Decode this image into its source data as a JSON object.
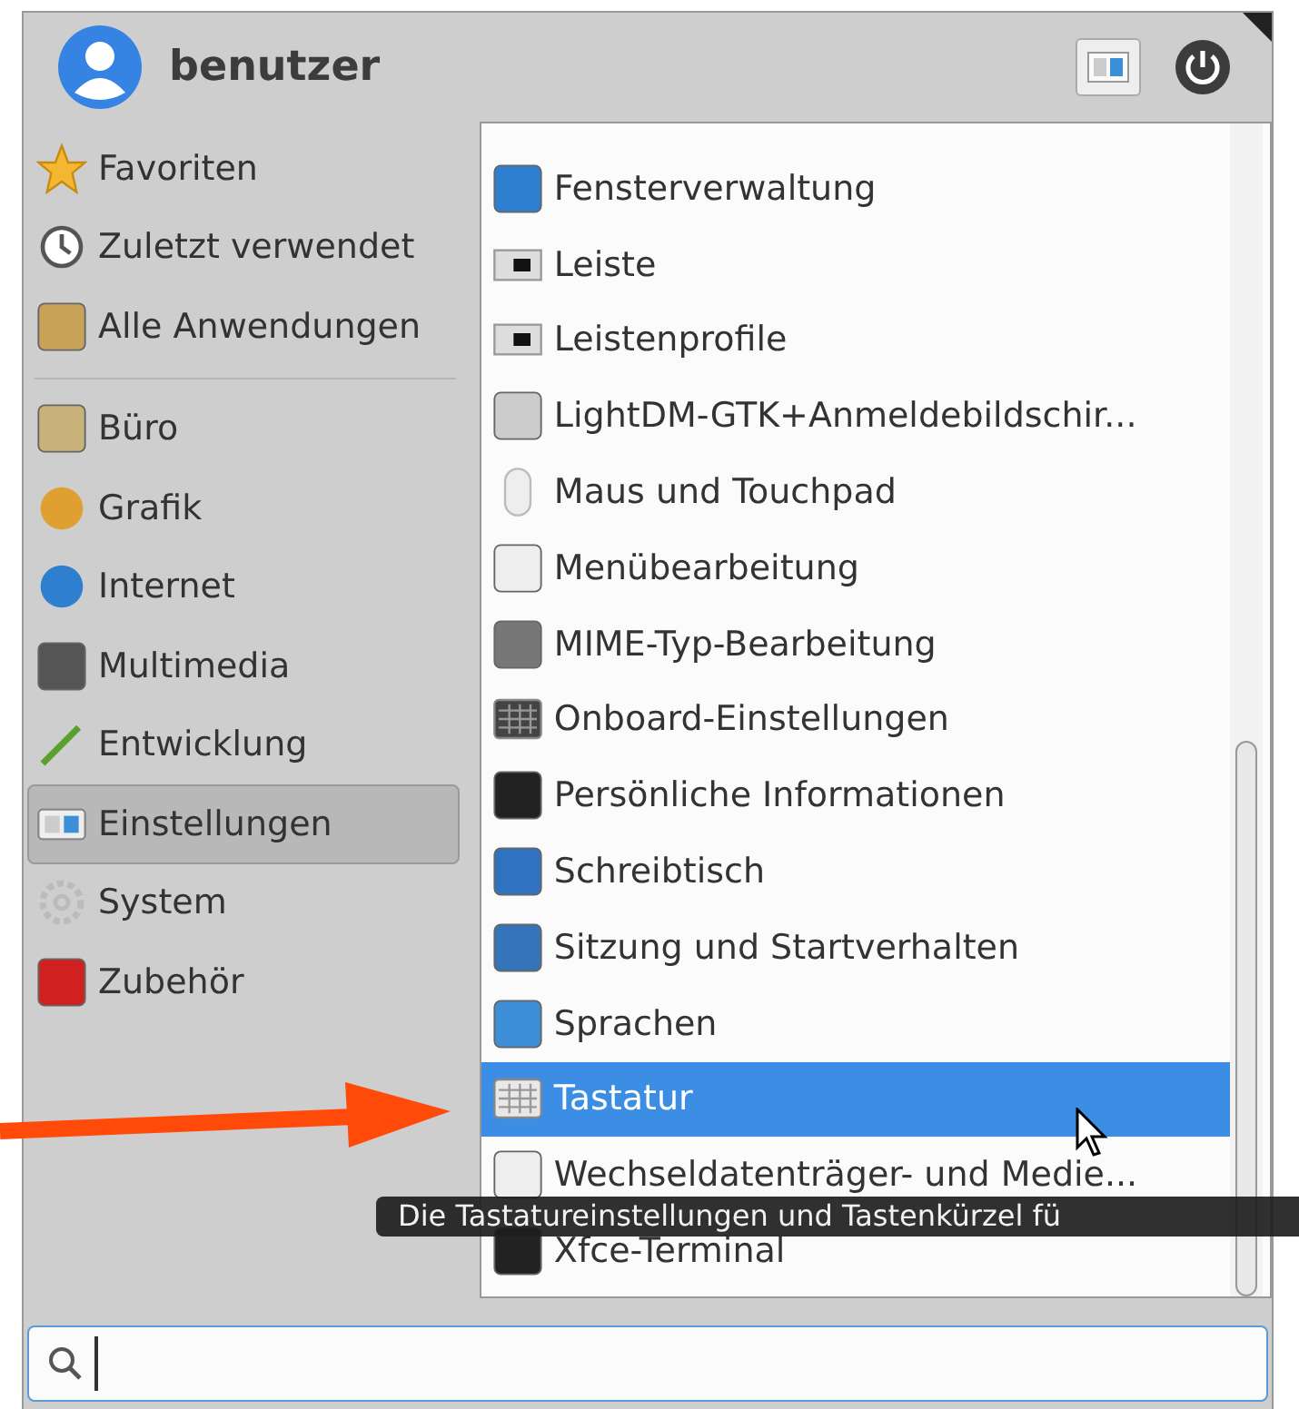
{
  "user": {
    "name": "benutzer"
  },
  "sidebar": {
    "places": [
      {
        "label": "Favoriten",
        "selected": false
      },
      {
        "label": "Zuletzt verwendet",
        "selected": false
      },
      {
        "label": "Alle Anwendungen",
        "selected": false
      }
    ],
    "categories": [
      {
        "label": "Büro",
        "selected": false
      },
      {
        "label": "Grafik",
        "selected": false
      },
      {
        "label": "Internet",
        "selected": false
      },
      {
        "label": "Multimedia",
        "selected": false
      },
      {
        "label": "Entwicklung",
        "selected": false
      },
      {
        "label": "Einstellungen",
        "selected": true
      },
      {
        "label": "System",
        "selected": false
      },
      {
        "label": "Zubehör",
        "selected": false
      }
    ]
  },
  "apps": [
    {
      "label": "Fensterverwaltung",
      "selected": false
    },
    {
      "label": "Leiste",
      "selected": false
    },
    {
      "label": "Leistenprofile",
      "selected": false
    },
    {
      "label": "LightDM-GTK+Anmeldebildschir...",
      "selected": false
    },
    {
      "label": "Maus und Touchpad",
      "selected": false
    },
    {
      "label": "Menübearbeitung",
      "selected": false
    },
    {
      "label": "MIME-Typ-Bearbeitung",
      "selected": false
    },
    {
      "label": "Onboard-Einstellungen",
      "selected": false
    },
    {
      "label": "Persönliche Informationen",
      "selected": false
    },
    {
      "label": "Schreibtisch",
      "selected": false
    },
    {
      "label": "Sitzung und Startverhalten",
      "selected": false
    },
    {
      "label": "Sprachen",
      "selected": false
    },
    {
      "label": "Tastatur",
      "selected": true
    },
    {
      "label": "Wechseldatenträger- und Medie...",
      "selected": false
    },
    {
      "label": "Xfce-Terminal",
      "selected": false
    }
  ],
  "tooltip": {
    "text": "Die Tastatureinstellungen und Tastenkürzel fü"
  }
}
